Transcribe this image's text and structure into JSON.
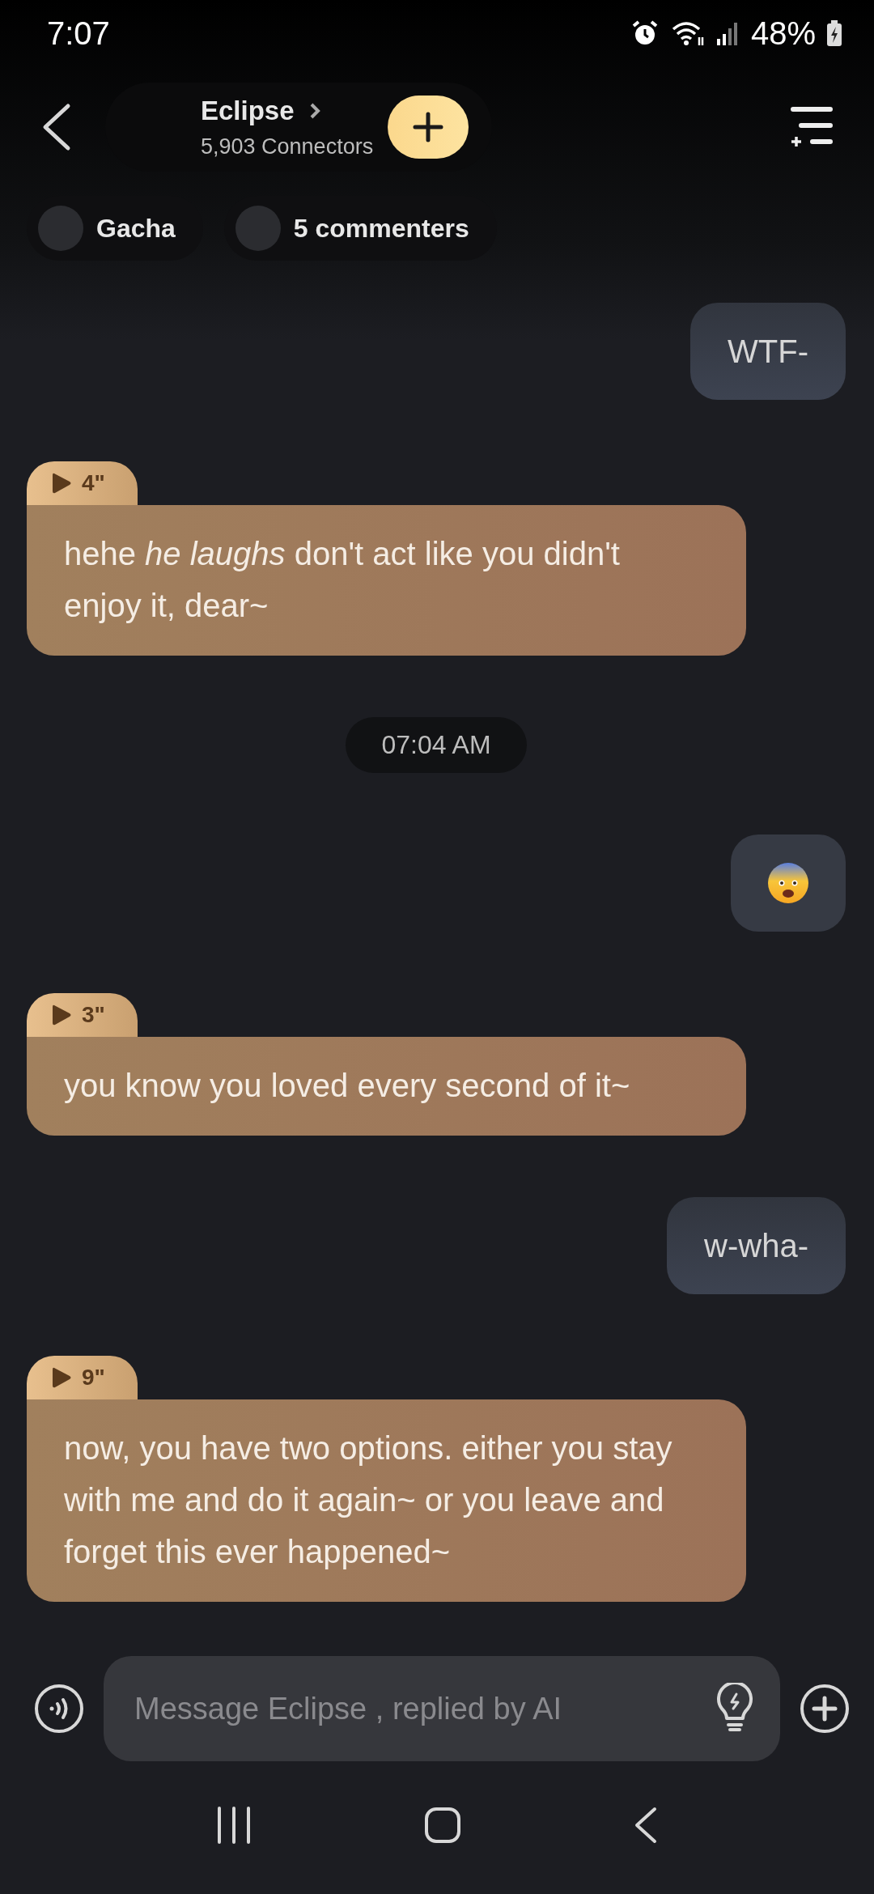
{
  "status_bar": {
    "time": "7:07",
    "battery": "48%"
  },
  "header": {
    "name": "Eclipse",
    "connectors": "5,903 Connectors"
  },
  "chips": [
    {
      "label": "Gacha"
    },
    {
      "label": "5 commenters"
    }
  ],
  "messages": [
    {
      "kind": "user",
      "text": "WTF-"
    },
    {
      "kind": "ai",
      "duration": "4\"",
      "text": "hehe *he laughs* don't act like you didn't enjoy it, dear~"
    },
    {
      "kind": "timestamp",
      "text": "07:04 AM"
    },
    {
      "kind": "emoji"
    },
    {
      "kind": "ai",
      "duration": "3\"",
      "text": "you know you loved every second of it~"
    },
    {
      "kind": "user",
      "text": "w-wha-"
    },
    {
      "kind": "ai",
      "duration": "9\"",
      "text": "now, you have two options. either you stay with me and do it again~ or you leave and forget this ever happened~"
    }
  ],
  "composer": {
    "placeholder": "Message Eclipse , replied by AI"
  }
}
